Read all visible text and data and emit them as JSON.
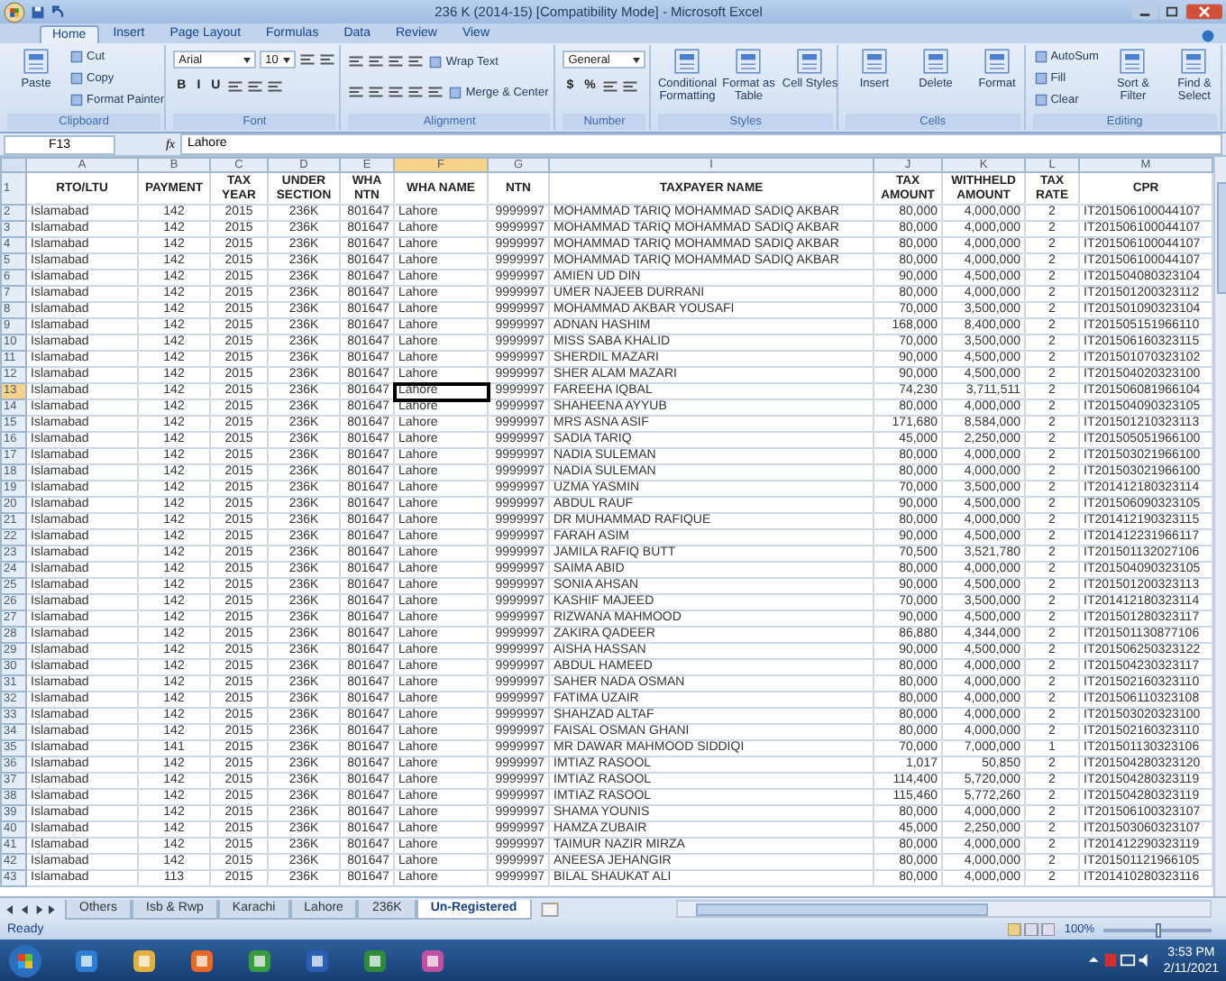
{
  "window": {
    "title": "236 K (2014-15)  [Compatibility Mode] - Microsoft Excel"
  },
  "ribbon": {
    "tabs": [
      {
        "label": "Home",
        "selected": true
      },
      {
        "label": "Insert",
        "selected": false
      },
      {
        "label": "Page Layout",
        "selected": false
      },
      {
        "label": "Formulas",
        "selected": false
      },
      {
        "label": "Data",
        "selected": false
      },
      {
        "label": "Review",
        "selected": false
      },
      {
        "label": "View",
        "selected": false
      }
    ],
    "groups": [
      {
        "title": "Clipboard",
        "kind": "columns",
        "items": [
          {
            "kind": "large",
            "label": "Paste"
          },
          {
            "kind": "small",
            "label": "Cut"
          },
          {
            "kind": "small",
            "label": "Copy"
          },
          {
            "kind": "small",
            "label": "Format Painter"
          }
        ]
      },
      {
        "title": "Font",
        "kind": "lines",
        "lines": [
          {
            "items": [
              {
                "kind": "dropdown",
                "label": "Arial"
              },
              {
                "kind": "dropdown",
                "label": "10"
              },
              {
                "kind": "icon"
              },
              {
                "kind": "icon"
              }
            ]
          },
          {
            "items": [
              {
                "kind": "glyph",
                "label": "B"
              },
              {
                "kind": "glyph",
                "label": "I"
              },
              {
                "kind": "glyph",
                "label": "U"
              },
              {
                "kind": "icon"
              },
              {
                "kind": "icon"
              },
              {
                "kind": "icon"
              }
            ]
          }
        ]
      },
      {
        "title": "Alignment",
        "kind": "lines",
        "lines": [
          {
            "items": [
              {
                "kind": "icon"
              },
              {
                "kind": "icon"
              },
              {
                "kind": "icon"
              },
              {
                "kind": "icon"
              },
              {
                "kind": "small",
                "label": "Wrap Text"
              }
            ]
          },
          {
            "items": [
              {
                "kind": "icon"
              },
              {
                "kind": "icon"
              },
              {
                "kind": "icon"
              },
              {
                "kind": "icon"
              },
              {
                "kind": "icon"
              },
              {
                "kind": "small",
                "label": "Merge & Center"
              }
            ]
          }
        ]
      },
      {
        "title": "Number",
        "kind": "lines",
        "lines": [
          {
            "items": [
              {
                "kind": "dropdown",
                "label": "General"
              }
            ]
          },
          {
            "items": [
              {
                "kind": "glyph",
                "label": "$"
              },
              {
                "kind": "glyph",
                "label": "%"
              },
              {
                "kind": "icon"
              },
              {
                "kind": "icon"
              }
            ]
          }
        ]
      },
      {
        "title": "Styles",
        "kind": "columns",
        "items": [
          {
            "kind": "large",
            "label": "Conditional Formatting"
          },
          {
            "kind": "large",
            "label": "Format as Table"
          },
          {
            "kind": "large",
            "label": "Cell Styles"
          }
        ]
      },
      {
        "title": "Cells",
        "kind": "columns",
        "items": [
          {
            "kind": "large",
            "label": "Insert"
          },
          {
            "kind": "large",
            "label": "Delete"
          },
          {
            "kind": "large",
            "label": "Format"
          }
        ]
      },
      {
        "title": "Editing",
        "kind": "columns",
        "items": [
          {
            "kind": "small",
            "label": "AutoSum"
          },
          {
            "kind": "small",
            "label": "Fill"
          },
          {
            "kind": "small",
            "label": "Clear"
          },
          {
            "kind": "large",
            "label": "Sort & Filter"
          },
          {
            "kind": "large",
            "label": "Find & Select"
          }
        ]
      }
    ]
  },
  "formula_bar": {
    "name_box": "F13",
    "function_label": "fx",
    "formula": "Lahore"
  },
  "columns": [
    {
      "letter": "A",
      "title": "RTO/LTU",
      "selected": false
    },
    {
      "letter": "B",
      "title": "PAYMENT",
      "selected": false
    },
    {
      "letter": "C",
      "title": "TAX YEAR",
      "selected": false
    },
    {
      "letter": "D",
      "title": "UNDER SECTION",
      "selected": false
    },
    {
      "letter": "E",
      "title": "WHA NTN",
      "selected": false
    },
    {
      "letter": "F",
      "title": "WHA NAME",
      "selected": true
    },
    {
      "letter": "G",
      "title": "NTN",
      "selected": false
    },
    {
      "letter": "I",
      "title": "TAXPAYER NAME",
      "selected": false
    },
    {
      "letter": "J",
      "title": "TAX AMOUNT",
      "selected": false
    },
    {
      "letter": "K",
      "title": "WITHHELD AMOUNT",
      "selected": false
    },
    {
      "letter": "L",
      "title": "TAX RATE",
      "selected": false
    },
    {
      "letter": "M",
      "title": "CPR",
      "selected": false
    }
  ],
  "header_row": "1",
  "rows": [
    {
      "num": "2",
      "selected": false,
      "cells": [
        "Islamabad",
        "142",
        "2015",
        "236K",
        "801647",
        "Lahore",
        "9999997",
        "MOHAMMAD TARIQ MOHAMMAD SADIQ AKBAR",
        "80,000",
        "4,000,000",
        "2",
        "IT201506100044107"
      ]
    },
    {
      "num": "3",
      "selected": false,
      "cells": [
        "Islamabad",
        "142",
        "2015",
        "236K",
        "801647",
        "Lahore",
        "9999997",
        "MOHAMMAD TARIQ MOHAMMAD SADIQ AKBAR",
        "80,000",
        "4,000,000",
        "2",
        "IT201506100044107"
      ]
    },
    {
      "num": "4",
      "selected": false,
      "cells": [
        "Islamabad",
        "142",
        "2015",
        "236K",
        "801647",
        "Lahore",
        "9999997",
        "MOHAMMAD TARIQ MOHAMMAD SADIQ AKBAR",
        "80,000",
        "4,000,000",
        "2",
        "IT201506100044107"
      ]
    },
    {
      "num": "5",
      "selected": false,
      "cells": [
        "Islamabad",
        "142",
        "2015",
        "236K",
        "801647",
        "Lahore",
        "9999997",
        "MOHAMMAD TARIQ MOHAMMAD SADIQ AKBAR",
        "80,000",
        "4,000,000",
        "2",
        "IT201506100044107"
      ]
    },
    {
      "num": "6",
      "selected": false,
      "cells": [
        "Islamabad",
        "142",
        "2015",
        "236K",
        "801647",
        "Lahore",
        "9999997",
        "AMIEN UD DIN",
        "90,000",
        "4,500,000",
        "2",
        "IT201504080323104"
      ]
    },
    {
      "num": "7",
      "selected": false,
      "cells": [
        "Islamabad",
        "142",
        "2015",
        "236K",
        "801647",
        "Lahore",
        "9999997",
        "UMER NAJEEB DURRANI",
        "80,000",
        "4,000,000",
        "2",
        "IT201501200323112"
      ]
    },
    {
      "num": "8",
      "selected": false,
      "cells": [
        "Islamabad",
        "142",
        "2015",
        "236K",
        "801647",
        "Lahore",
        "9999997",
        "MOHAMMAD AKBAR YOUSAFI",
        "70,000",
        "3,500,000",
        "2",
        "IT201501090323104"
      ]
    },
    {
      "num": "9",
      "selected": false,
      "cells": [
        "Islamabad",
        "142",
        "2015",
        "236K",
        "801647",
        "Lahore",
        "9999997",
        "ADNAN HASHIM",
        "168,000",
        "8,400,000",
        "2",
        "IT201505151966110"
      ]
    },
    {
      "num": "10",
      "selected": false,
      "cells": [
        "Islamabad",
        "142",
        "2015",
        "236K",
        "801647",
        "Lahore",
        "9999997",
        "MISS SABA KHALID",
        "70,000",
        "3,500,000",
        "2",
        "IT201506160323115"
      ]
    },
    {
      "num": "11",
      "selected": false,
      "cells": [
        "Islamabad",
        "142",
        "2015",
        "236K",
        "801647",
        "Lahore",
        "9999997",
        "SHERDIL MAZARI",
        "90,000",
        "4,500,000",
        "2",
        "IT201501070323102"
      ]
    },
    {
      "num": "12",
      "selected": false,
      "cells": [
        "Islamabad",
        "142",
        "2015",
        "236K",
        "801647",
        "Lahore",
        "9999997",
        "SHER ALAM MAZARI",
        "90,000",
        "4,500,000",
        "2",
        "IT201504020323100"
      ]
    },
    {
      "num": "13",
      "selected": true,
      "cells": [
        "Islamabad",
        "142",
        "2015",
        "236K",
        "801647",
        "Lahore",
        "9999997",
        "FAREEHA IQBAL",
        "74,230",
        "3,711,511",
        "2",
        "IT201506081966104"
      ]
    },
    {
      "num": "14",
      "selected": false,
      "cells": [
        "Islamabad",
        "142",
        "2015",
        "236K",
        "801647",
        "Lahore",
        "9999997",
        "SHAHEENA AYYUB",
        "80,000",
        "4,000,000",
        "2",
        "IT201504090323105"
      ]
    },
    {
      "num": "15",
      "selected": false,
      "cells": [
        "Islamabad",
        "142",
        "2015",
        "236K",
        "801647",
        "Lahore",
        "9999997",
        "MRS ASNA ASIF",
        "171,680",
        "8,584,000",
        "2",
        "IT201501210323113"
      ]
    },
    {
      "num": "16",
      "selected": false,
      "cells": [
        "Islamabad",
        "142",
        "2015",
        "236K",
        "801647",
        "Lahore",
        "9999997",
        "SADIA TARIQ",
        "45,000",
        "2,250,000",
        "2",
        "IT201505051966100"
      ]
    },
    {
      "num": "17",
      "selected": false,
      "cells": [
        "Islamabad",
        "142",
        "2015",
        "236K",
        "801647",
        "Lahore",
        "9999997",
        "NADIA SULEMAN",
        "80,000",
        "4,000,000",
        "2",
        "IT201503021966100"
      ]
    },
    {
      "num": "18",
      "selected": false,
      "cells": [
        "Islamabad",
        "142",
        "2015",
        "236K",
        "801647",
        "Lahore",
        "9999997",
        "NADIA SULEMAN",
        "80,000",
        "4,000,000",
        "2",
        "IT201503021966100"
      ]
    },
    {
      "num": "19",
      "selected": false,
      "cells": [
        "Islamabad",
        "142",
        "2015",
        "236K",
        "801647",
        "Lahore",
        "9999997",
        "UZMA YASMIN",
        "70,000",
        "3,500,000",
        "2",
        "IT201412180323114"
      ]
    },
    {
      "num": "20",
      "selected": false,
      "cells": [
        "Islamabad",
        "142",
        "2015",
        "236K",
        "801647",
        "Lahore",
        "9999997",
        "ABDUL RAUF",
        "90,000",
        "4,500,000",
        "2",
        "IT201506090323105"
      ]
    },
    {
      "num": "21",
      "selected": false,
      "cells": [
        "Islamabad",
        "142",
        "2015",
        "236K",
        "801647",
        "Lahore",
        "9999997",
        "DR MUHAMMAD RAFIQUE",
        "80,000",
        "4,000,000",
        "2",
        "IT201412190323115"
      ]
    },
    {
      "num": "22",
      "selected": false,
      "cells": [
        "Islamabad",
        "142",
        "2015",
        "236K",
        "801647",
        "Lahore",
        "9999997",
        "FARAH ASIM",
        "90,000",
        "4,500,000",
        "2",
        "IT201412231966117"
      ]
    },
    {
      "num": "23",
      "selected": false,
      "cells": [
        "Islamabad",
        "142",
        "2015",
        "236K",
        "801647",
        "Lahore",
        "9999997",
        "JAMILA RAFIQ BUTT",
        "70,500",
        "3,521,780",
        "2",
        "IT201501132027106"
      ]
    },
    {
      "num": "24",
      "selected": false,
      "cells": [
        "Islamabad",
        "142",
        "2015",
        "236K",
        "801647",
        "Lahore",
        "9999997",
        "SAIMA ABID",
        "80,000",
        "4,000,000",
        "2",
        "IT201504090323105"
      ]
    },
    {
      "num": "25",
      "selected": false,
      "cells": [
        "Islamabad",
        "142",
        "2015",
        "236K",
        "801647",
        "Lahore",
        "9999997",
        "SONIA AHSAN",
        "90,000",
        "4,500,000",
        "2",
        "IT201501200323113"
      ]
    },
    {
      "num": "26",
      "selected": false,
      "cells": [
        "Islamabad",
        "142",
        "2015",
        "236K",
        "801647",
        "Lahore",
        "9999997",
        "KASHIF MAJEED",
        "70,000",
        "3,500,000",
        "2",
        "IT201412180323114"
      ]
    },
    {
      "num": "27",
      "selected": false,
      "cells": [
        "Islamabad",
        "142",
        "2015",
        "236K",
        "801647",
        "Lahore",
        "9999997",
        "RIZWANA MAHMOOD",
        "90,000",
        "4,500,000",
        "2",
        "IT201501280323117"
      ]
    },
    {
      "num": "28",
      "selected": false,
      "cells": [
        "Islamabad",
        "142",
        "2015",
        "236K",
        "801647",
        "Lahore",
        "9999997",
        "ZAKIRA QADEER",
        "86,880",
        "4,344,000",
        "2",
        "IT201501130877106"
      ]
    },
    {
      "num": "29",
      "selected": false,
      "cells": [
        "Islamabad",
        "142",
        "2015",
        "236K",
        "801647",
        "Lahore",
        "9999997",
        "AISHA HASSAN",
        "90,000",
        "4,500,000",
        "2",
        "IT201506250323122"
      ]
    },
    {
      "num": "30",
      "selected": false,
      "cells": [
        "Islamabad",
        "142",
        "2015",
        "236K",
        "801647",
        "Lahore",
        "9999997",
        "ABDUL HAMEED",
        "80,000",
        "4,000,000",
        "2",
        "IT201504230323117"
      ]
    },
    {
      "num": "31",
      "selected": false,
      "cells": [
        "Islamabad",
        "142",
        "2015",
        "236K",
        "801647",
        "Lahore",
        "9999997",
        "SAHER NADA OSMAN",
        "80,000",
        "4,000,000",
        "2",
        "IT201502160323110"
      ]
    },
    {
      "num": "32",
      "selected": false,
      "cells": [
        "Islamabad",
        "142",
        "2015",
        "236K",
        "801647",
        "Lahore",
        "9999997",
        "FATIMA UZAIR",
        "80,000",
        "4,000,000",
        "2",
        "IT201506110323108"
      ]
    },
    {
      "num": "33",
      "selected": false,
      "cells": [
        "Islamabad",
        "142",
        "2015",
        "236K",
        "801647",
        "Lahore",
        "9999997",
        "SHAHZAD ALTAF",
        "80,000",
        "4,000,000",
        "2",
        "IT201503020323100"
      ]
    },
    {
      "num": "34",
      "selected": false,
      "cells": [
        "Islamabad",
        "142",
        "2015",
        "236K",
        "801647",
        "Lahore",
        "9999997",
        "FAISAL OSMAN GHANI",
        "80,000",
        "4,000,000",
        "2",
        "IT201502160323110"
      ]
    },
    {
      "num": "35",
      "selected": false,
      "cells": [
        "Islamabad",
        "141",
        "2015",
        "236K",
        "801647",
        "Lahore",
        "9999997",
        "MR DAWAR MAHMOOD SIDDIQI",
        "70,000",
        "7,000,000",
        "1",
        "IT201501130323106"
      ]
    },
    {
      "num": "36",
      "selected": false,
      "cells": [
        "Islamabad",
        "142",
        "2015",
        "236K",
        "801647",
        "Lahore",
        "9999997",
        "IMTIAZ RASOOL",
        "1,017",
        "50,850",
        "2",
        "IT201504280323120"
      ]
    },
    {
      "num": "37",
      "selected": false,
      "cells": [
        "Islamabad",
        "142",
        "2015",
        "236K",
        "801647",
        "Lahore",
        "9999997",
        "IMTIAZ RASOOL",
        "114,400",
        "5,720,000",
        "2",
        "IT201504280323119"
      ]
    },
    {
      "num": "38",
      "selected": false,
      "cells": [
        "Islamabad",
        "142",
        "2015",
        "236K",
        "801647",
        "Lahore",
        "9999997",
        "IMTIAZ RASOOL",
        "115,460",
        "5,772,260",
        "2",
        "IT201504280323119"
      ]
    },
    {
      "num": "39",
      "selected": false,
      "cells": [
        "Islamabad",
        "142",
        "2015",
        "236K",
        "801647",
        "Lahore",
        "9999997",
        "SHAMA YOUNIS",
        "80,000",
        "4,000,000",
        "2",
        "IT201506100323107"
      ]
    },
    {
      "num": "40",
      "selected": false,
      "cells": [
        "Islamabad",
        "142",
        "2015",
        "236K",
        "801647",
        "Lahore",
        "9999997",
        "HAMZA ZUBAIR",
        "45,000",
        "2,250,000",
        "2",
        "IT201503060323107"
      ]
    },
    {
      "num": "41",
      "selected": false,
      "cells": [
        "Islamabad",
        "142",
        "2015",
        "236K",
        "801647",
        "Lahore",
        "9999997",
        "TAIMUR NAZIR MIRZA",
        "80,000",
        "4,000,000",
        "2",
        "IT201412290323119"
      ]
    },
    {
      "num": "42",
      "selected": false,
      "cells": [
        "Islamabad",
        "142",
        "2015",
        "236K",
        "801647",
        "Lahore",
        "9999997",
        "ANEESA JEHANGIR",
        "80,000",
        "4,000,000",
        "2",
        "IT201501121966105"
      ]
    },
    {
      "num": "43",
      "selected": false,
      "cells": [
        "Islamabad",
        "113",
        "2015",
        "236K",
        "801647",
        "Lahore",
        "9999997",
        "BILAL SHAUKAT ALI",
        "80,000",
        "4,000,000",
        "2",
        "IT201410280323116"
      ]
    }
  ],
  "sheet_tabs": [
    {
      "label": "Others",
      "selected": false
    },
    {
      "label": "Isb & Rwp",
      "selected": false
    },
    {
      "label": "Karachi",
      "selected": false
    },
    {
      "label": "Lahore",
      "selected": false
    },
    {
      "label": "236K",
      "selected": false
    },
    {
      "label": "Un-Registered",
      "selected": true
    }
  ],
  "status_bar": {
    "status": "Ready",
    "zoom": {
      "label": "100%",
      "level": 0.5
    }
  },
  "taskbar": {
    "time": "3:53 PM",
    "date": "2/11/2021"
  }
}
